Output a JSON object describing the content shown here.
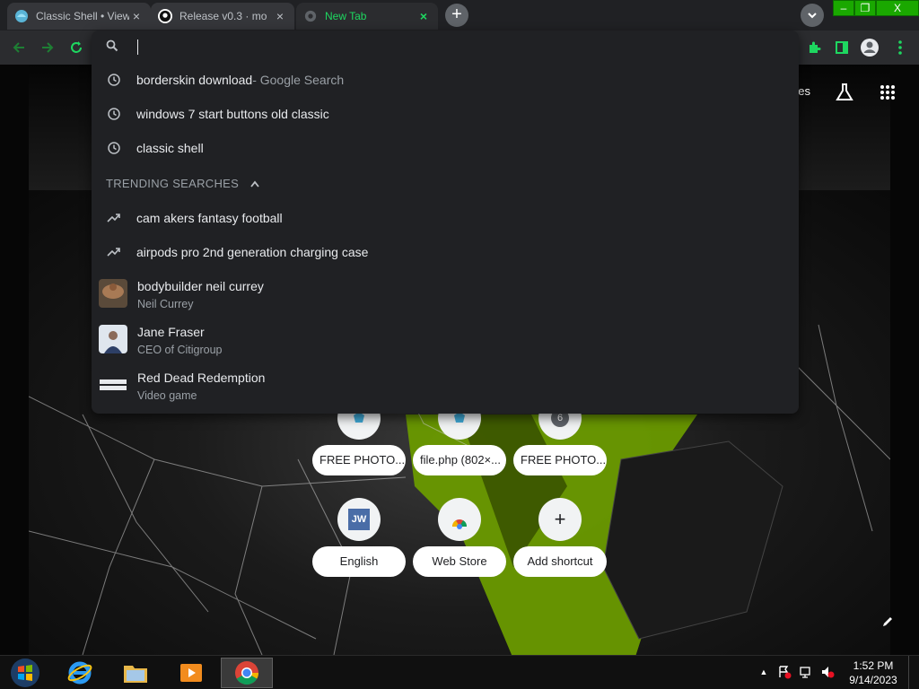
{
  "browser": {
    "tabs": [
      {
        "title": "Classic Shell • View",
        "active": false
      },
      {
        "title": "Release v0.3 · mo",
        "active": false
      },
      {
        "title": "New Tab",
        "active": true
      }
    ],
    "new_tab_symbol": "+",
    "window_controls": {
      "minimize": "–",
      "maximize": "❐",
      "close": "X"
    }
  },
  "omnibox": {
    "value": "",
    "suggestions": [
      {
        "icon": "history-icon",
        "text": "borderskin download",
        "desc": " - Google Search"
      },
      {
        "icon": "history-icon",
        "text": "windows 7 start buttons old classic",
        "desc": ""
      },
      {
        "icon": "history-icon",
        "text": "classic shell",
        "desc": ""
      }
    ],
    "trending_header": "TRENDING SEARCHES",
    "trending": [
      {
        "icon": "trending-icon",
        "text": "cam akers fantasy football"
      },
      {
        "icon": "trending-icon",
        "text": "airpods pro 2nd generation charging case"
      }
    ],
    "rich": [
      {
        "title": "bodybuilder neil currey",
        "subtitle": "Neil Currey"
      },
      {
        "title": "Jane Fraser",
        "subtitle": "CEO of Citigroup"
      },
      {
        "title": "Red Dead Redemption",
        "subtitle": "Video game"
      }
    ]
  },
  "ntp": {
    "top_link_partial": "ges",
    "shortcuts_row1": [
      {
        "label": "FREE PHOTO...",
        "icon": "photo-favicon-icon"
      },
      {
        "label": "file.php (802×...",
        "icon": "photo-favicon-icon"
      },
      {
        "label": "FREE PHOTO...",
        "icon": "number-favicon-icon",
        "badge": "6"
      }
    ],
    "shortcuts_row2": [
      {
        "label": "English",
        "icon": "jw-icon",
        "badge": "JW"
      },
      {
        "label": "Web Store",
        "icon": "webstore-icon"
      },
      {
        "label": "Add shortcut",
        "icon": "plus-icon",
        "badge": "+"
      }
    ]
  },
  "taskbar": {
    "time": "1:52 PM",
    "date": "9/14/2023",
    "up_arrow": "▲"
  },
  "colors": {
    "accent_green": "#1ed760",
    "omnibox_bg": "#202124",
    "toolbar_bg": "#2b2c2f"
  }
}
